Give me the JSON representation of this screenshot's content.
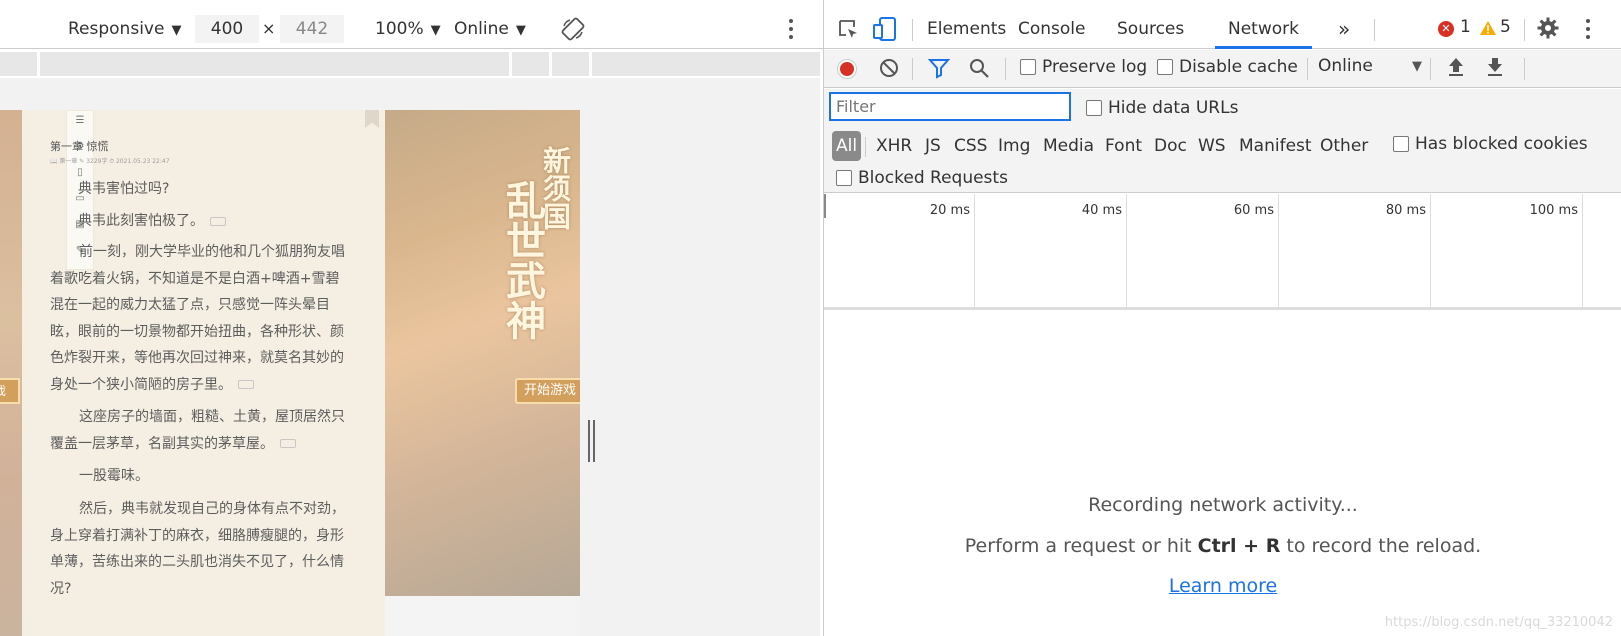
{
  "device_toolbar": {
    "mode": "Responsive",
    "width": "400",
    "separator": "×",
    "height": "442",
    "zoom": "100%",
    "throttle": "Online"
  },
  "reader": {
    "chapter_title": "第一章 惊慌",
    "meta": "📖 第一章   ✎ 3229字   ⏱ 2021.05.23 22:47",
    "paragraphs": [
      "典韦害怕过吗?",
      "典韦此刻害怕极了。",
      "前一刻，刚大学毕业的他和几个狐朋狗友唱着歌吃着火锅，不知道是不是白酒+啤酒+雪碧混在一起的威力太猛了点，只感觉一阵头晕目眩，眼前的一切景物都开始扭曲，各种形状、颜色炸裂开来，等他再次回过神来，就莫名其妙的身处一个狭小简陋的房子里。",
      "这座房子的墙面，粗糙、土黄，屋顶居然只覆盖一层茅草，名副其实的茅草屋。",
      "一股霉味。",
      "然后，典韦就发现自己的身体有点不对劲，身上穿着打满补丁的麻衣，细胳膊瘦腿的，身形单薄，苦练出来的二头肌也消失不见了，什么情况?"
    ],
    "banner_line1": "新须国",
    "banner_line2": "乱世武神",
    "start_button": "开始游戏",
    "left_button": "游戏"
  },
  "devtools": {
    "tabs": [
      "Elements",
      "Console",
      "Sources",
      "Network"
    ],
    "more_tabs": "»",
    "error_count": "1",
    "warning_count": "5",
    "preserve_log": "Preserve log",
    "disable_cache": "Disable cache",
    "throttle": "Online",
    "filter_placeholder": "Filter",
    "hide_data_urls": "Hide data URLs",
    "types": [
      "All",
      "XHR",
      "JS",
      "CSS",
      "Img",
      "Media",
      "Font",
      "Doc",
      "WS",
      "Manifest",
      "Other"
    ],
    "has_blocked_cookies": "Has blocked cookies",
    "blocked_requests": "Blocked Requests",
    "timeline_labels": [
      "20 ms",
      "40 ms",
      "60 ms",
      "80 ms",
      "100 ms"
    ],
    "recording_title": "Recording network activity...",
    "hint_prefix": "Perform a request or hit ",
    "hint_ctrl": "Ctrl",
    "hint_plus": " + ",
    "hint_key": "R",
    "hint_suffix": " to record the reload.",
    "learn_more": "Learn more"
  },
  "colors": {
    "accent": "#1a73e8",
    "record": "#d93025",
    "warning": "#f9ab00",
    "reader_bg": "#f3ebdc"
  },
  "watermark": "https://blog.csdn.net/qq_33210042"
}
